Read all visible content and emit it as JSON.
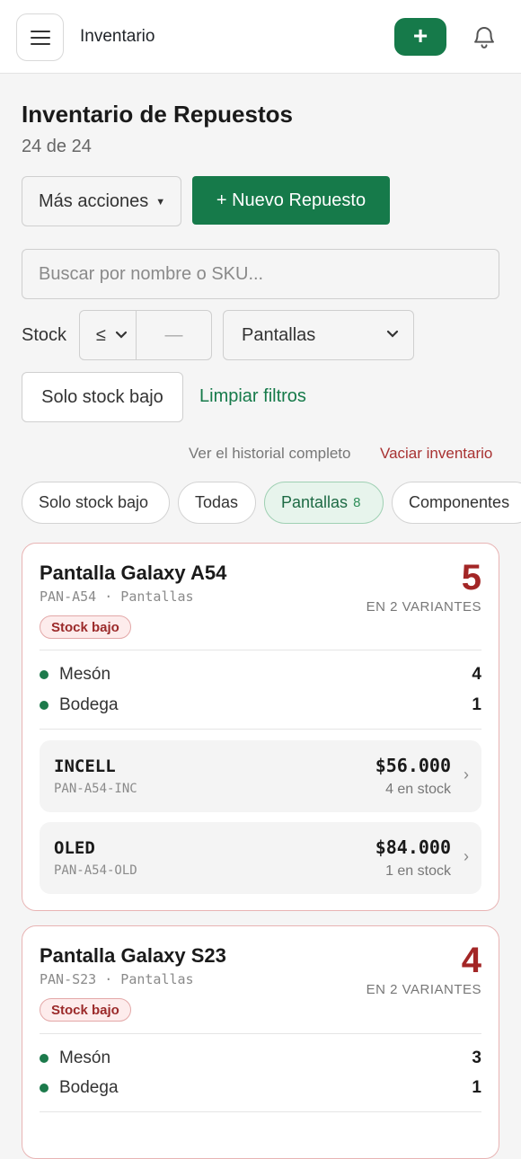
{
  "header": {
    "title": "Inventario",
    "add_label": "+"
  },
  "page": {
    "title": "Inventario de Repuestos",
    "count": "24 de 24"
  },
  "actions": {
    "more_label": "Más acciones",
    "new_label": "+ Nuevo Repuesto"
  },
  "search": {
    "placeholder": "Buscar por nombre o SKU..."
  },
  "filters": {
    "stock_label": "Stock",
    "operator": "≤",
    "stock_value": "—",
    "category": "Pantallas",
    "low_stock_button": "Solo stock bajo",
    "clear_link": "Limpiar filtros"
  },
  "links": {
    "history": "Ver el historial completo",
    "empty": "Vaciar inventario"
  },
  "chips": [
    {
      "label": "Solo stock bajo",
      "count": ""
    },
    {
      "label": "Todas",
      "count": ""
    },
    {
      "label": "Pantallas",
      "count": "8"
    },
    {
      "label": "Componentes",
      "count": ""
    }
  ],
  "products": [
    {
      "name": "Pantalla Galaxy A54",
      "sku": "PAN-A54 · Pantallas",
      "total": "5",
      "variants_label": "EN 2 VARIANTES",
      "badge": "Stock bajo",
      "locations": [
        {
          "name": "Mesón",
          "qty": "4"
        },
        {
          "name": "Bodega",
          "qty": "1"
        }
      ],
      "variants": [
        {
          "name": "INCELL",
          "sku": "PAN-A54-INC",
          "price": "$56.000",
          "stock": "4 en stock"
        },
        {
          "name": "OLED",
          "sku": "PAN-A54-OLD",
          "price": "$84.000",
          "stock": "1 en stock"
        }
      ]
    },
    {
      "name": "Pantalla Galaxy S23",
      "sku": "PAN-S23 · Pantallas",
      "total": "4",
      "variants_label": "EN 2 VARIANTES",
      "badge": "Stock bajo",
      "locations": [
        {
          "name": "Mesón",
          "qty": "3"
        },
        {
          "name": "Bodega",
          "qty": "1"
        }
      ]
    }
  ],
  "colors": {
    "brand": "#167a4a",
    "danger": "#a32626"
  }
}
